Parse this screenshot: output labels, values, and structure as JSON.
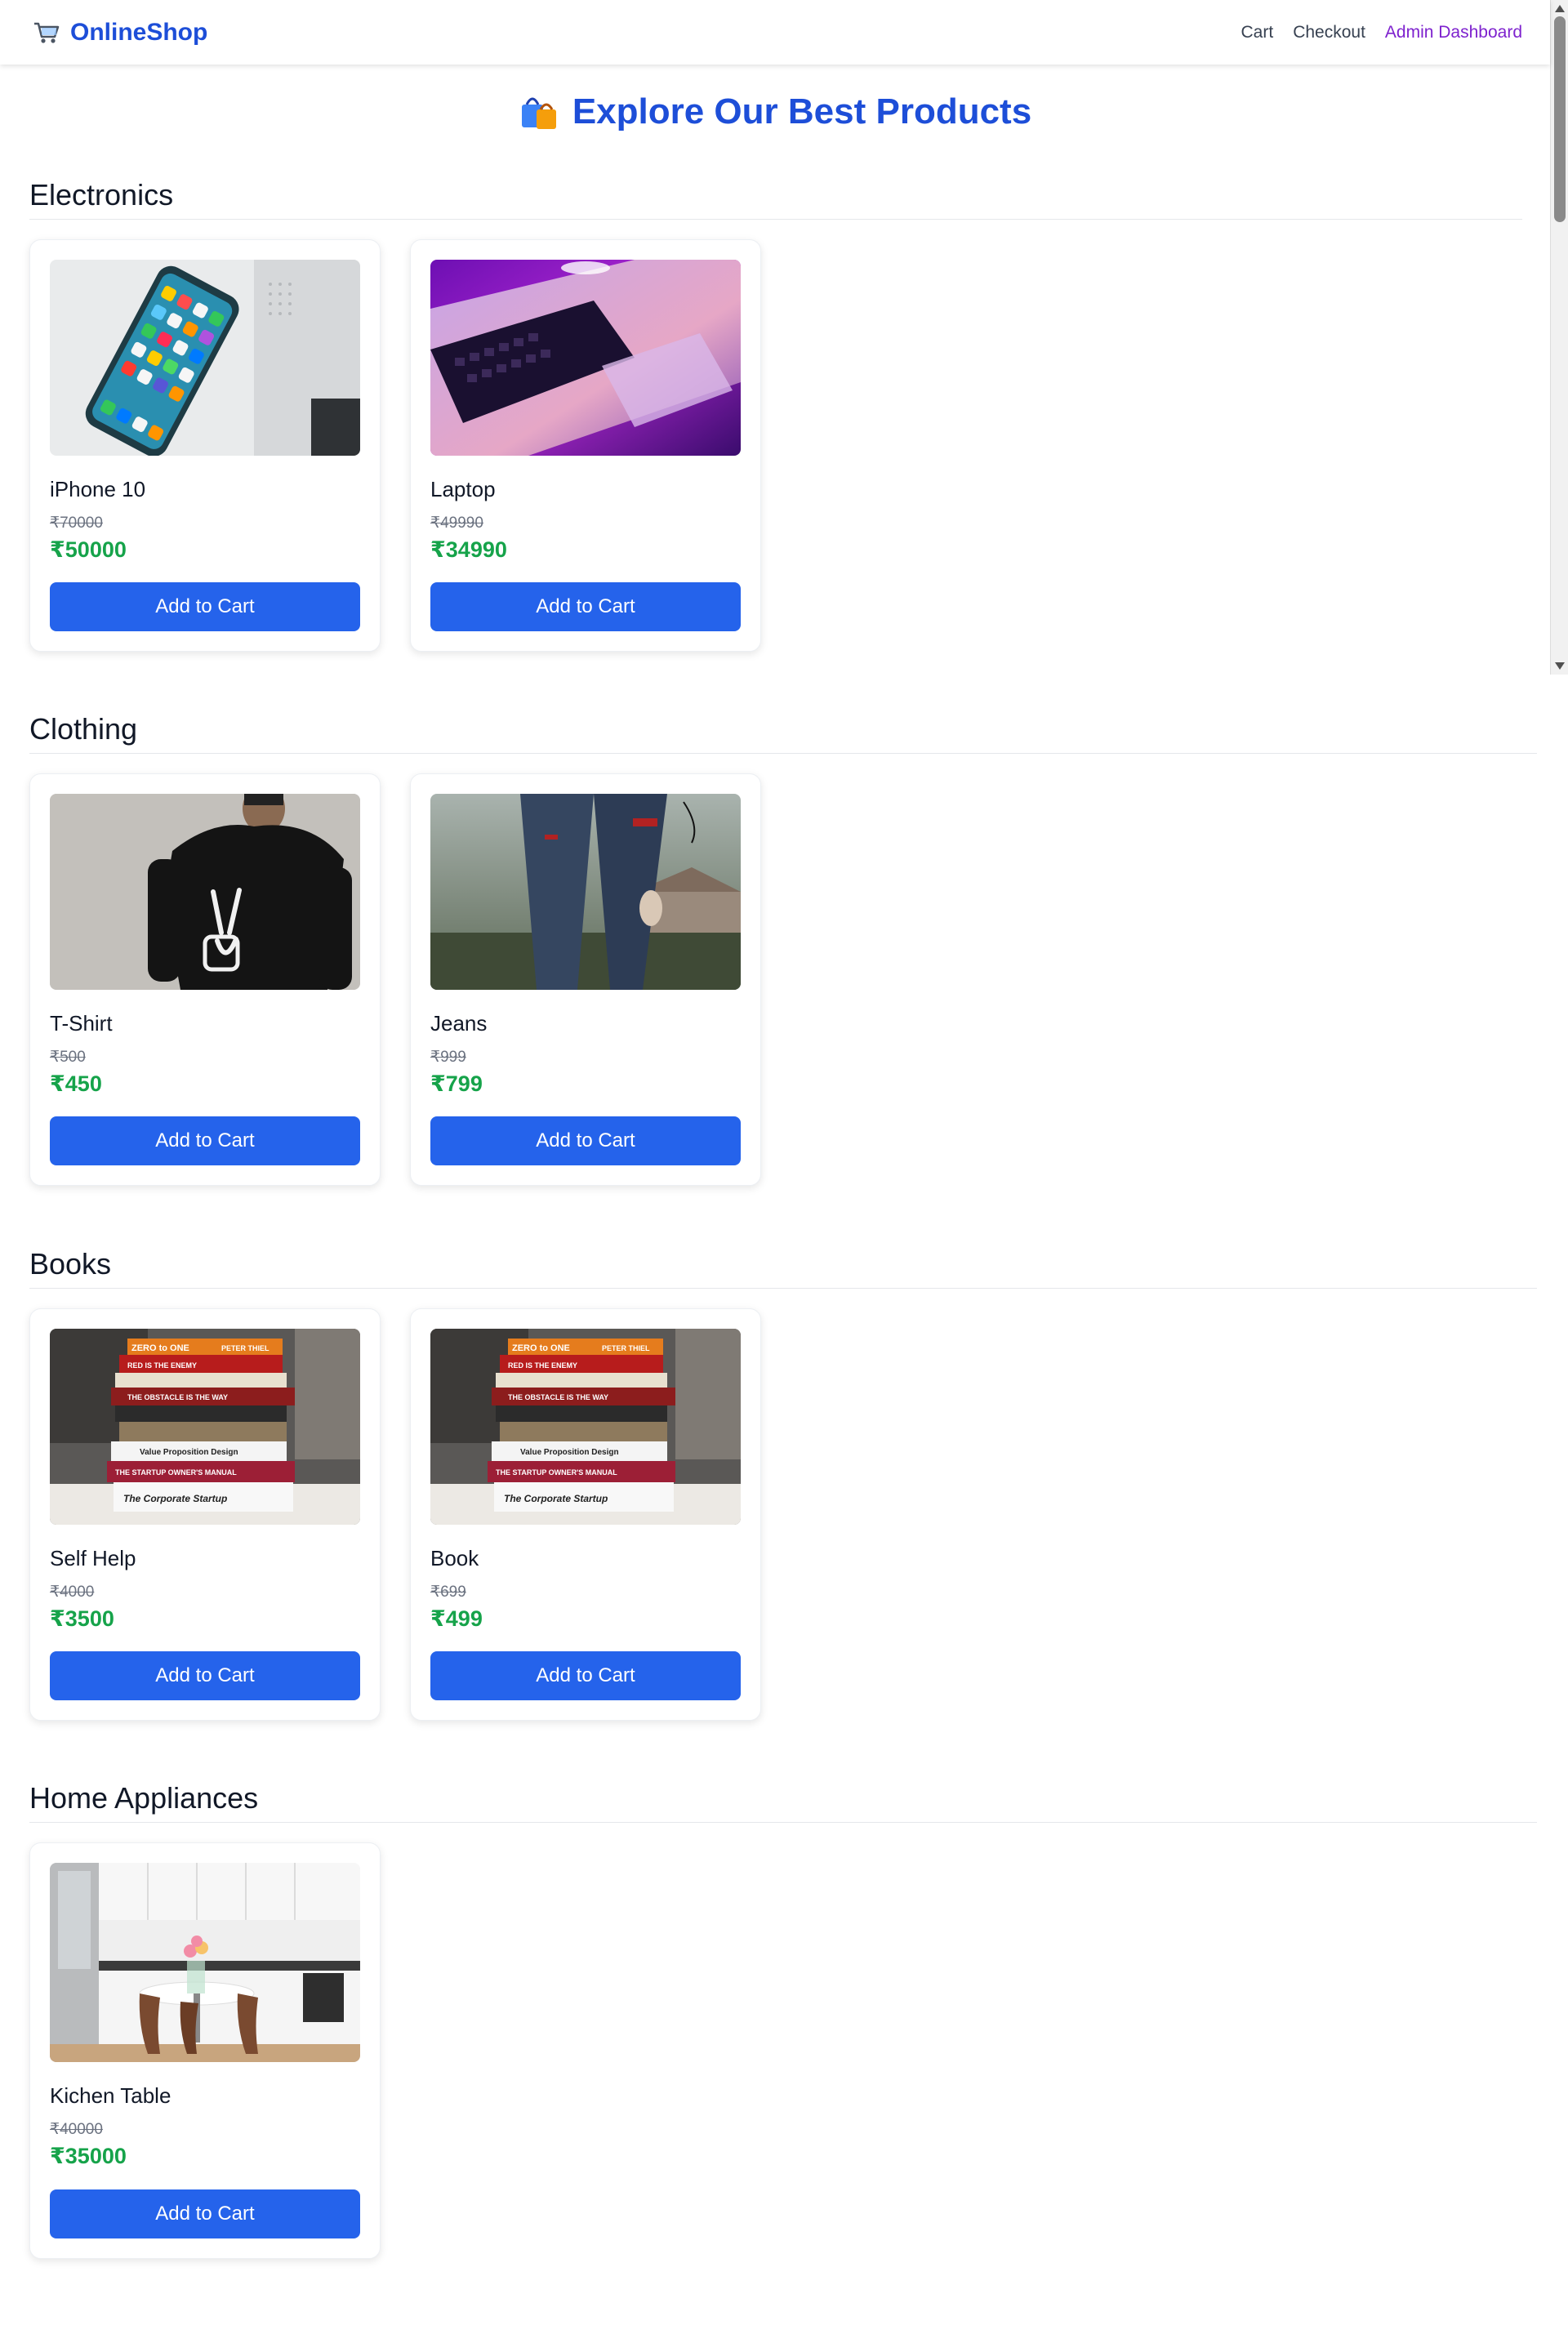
{
  "header": {
    "brand": "OnlineShop",
    "nav": [
      "Cart",
      "Checkout",
      "Admin Dashboard"
    ],
    "icon": "shopping-cart-icon"
  },
  "page_title": "Explore Our Best Products",
  "title_icon": "shopping-bags-icon",
  "add_to_cart_label": "Add to Cart",
  "colors": {
    "brand": "#1d4ed8",
    "button": "#2563eb",
    "price": "#16a34a",
    "admin_link": "#7e22ce"
  },
  "categories": [
    {
      "name": "Electronics",
      "products": [
        {
          "name": "iPhone 10",
          "old_price": "₹70000",
          "price": "₹50000",
          "image": "phone-on-laptop-photo"
        },
        {
          "name": "Laptop",
          "old_price": "₹49990",
          "price": "₹34990",
          "image": "laptop-purple-light-photo"
        }
      ]
    },
    {
      "name": "Clothing",
      "products": [
        {
          "name": "T-Shirt",
          "old_price": "₹500",
          "price": "₹450",
          "image": "black-tshirt-photo"
        },
        {
          "name": "Jeans",
          "old_price": "₹999",
          "price": "₹799",
          "image": "ripped-jeans-photo"
        }
      ]
    },
    {
      "name": "Books",
      "products": [
        {
          "name": "Self Help",
          "old_price": "₹4000",
          "price": "₹3500",
          "image": "book-stack-photo"
        },
        {
          "name": "Book",
          "old_price": "₹699",
          "price": "₹499",
          "image": "book-stack-photo"
        }
      ]
    },
    {
      "name": "Home Appliances",
      "products": [
        {
          "name": "Kichen Table",
          "old_price": "₹40000",
          "price": "₹35000",
          "image": "kitchen-table-photo"
        }
      ]
    }
  ],
  "book_spines": [
    "ZERO to ONE",
    "PETER THIEL",
    "RED IS THE ENEMY",
    "THE OBSTACLE IS THE WAY",
    "Value Proposition Design",
    "THE STARTUP OWNER'S MANUAL",
    "The Corporate Startup"
  ]
}
